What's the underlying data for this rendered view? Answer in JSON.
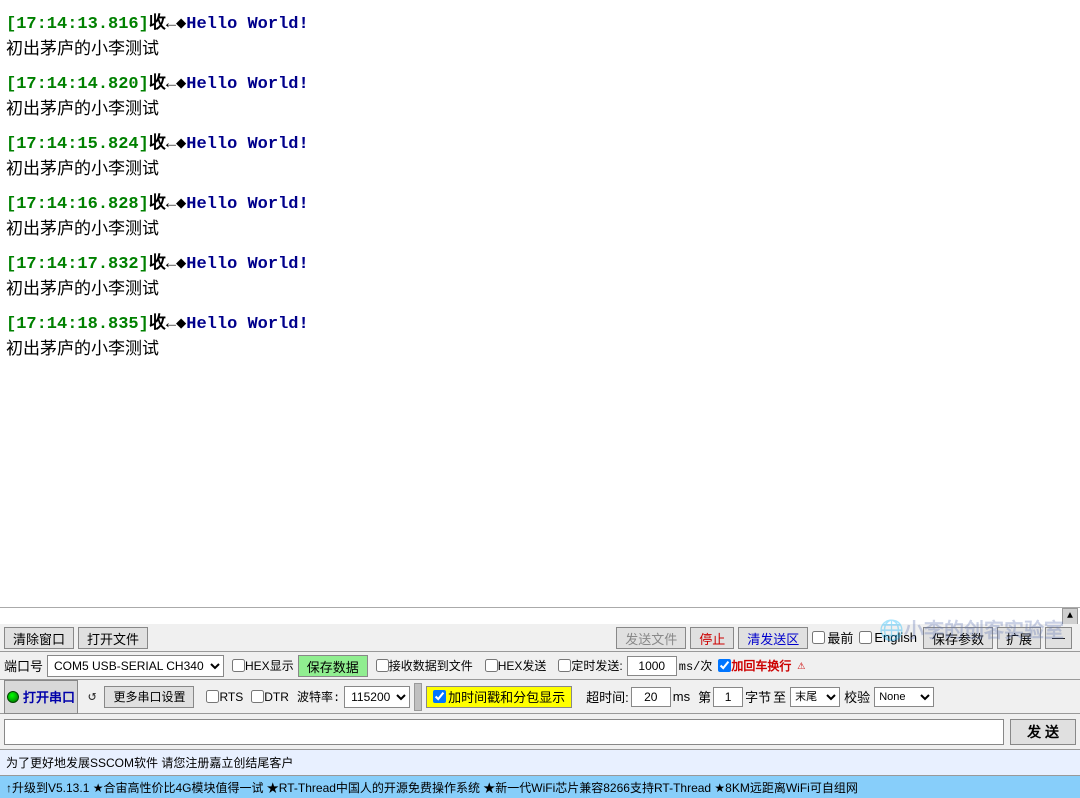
{
  "terminal": {
    "entries": [
      {
        "timestamp": "[17:14:13.816]",
        "label": "收←◆",
        "message": "Hello World!",
        "chinese": "初出茅庐的小李测试"
      },
      {
        "timestamp": "[17:14:14.820]",
        "label": "收←◆",
        "message": "Hello World!",
        "chinese": "初出茅庐的小李测试"
      },
      {
        "timestamp": "[17:14:15.824]",
        "label": "收←◆",
        "message": "Hello World!",
        "chinese": "初出茅庐的小李测试"
      },
      {
        "timestamp": "[17:14:16.828]",
        "label": "收←◆",
        "message": "Hello World!",
        "chinese": "初出茅庐的小李测试"
      },
      {
        "timestamp": "[17:14:17.832]",
        "label": "收←◆",
        "message": "Hello World!",
        "chinese": "初出茅庐的小李测试"
      },
      {
        "timestamp": "[17:14:18.835]",
        "label": "收←◆",
        "message": "Hello World!",
        "chinese": "初出茅庐的小李测试"
      }
    ]
  },
  "toolbar": {
    "clear_btn": "清除窗口",
    "open_file_btn": "打开文件",
    "send_file_btn": "发送文件",
    "stop_btn": "停止",
    "clear_send_btn": "清发送区",
    "last_checkbox": "最前",
    "english_checkbox": "English",
    "save_param_btn": "保存参数",
    "expand_btn": "扩展",
    "minimize_btn": "—"
  },
  "port_row": {
    "port_label": "端口号",
    "port_value": "COM5 USB-SERIAL CH340",
    "hex_display": "HEX显示",
    "save_data_btn": "保存数据",
    "receive_to_file": "接收数据到文件",
    "hex_send": "HEX发送",
    "timed_send": "定时发送:",
    "timed_value": "1000",
    "timed_unit": "ms/次",
    "newline": "加回车换行"
  },
  "open_row": {
    "open_port_btn": "打开串口",
    "refresh_icon": "↺",
    "multi_port": "更多串口设置",
    "add_time_label": "加时间戳和分包显示",
    "timeout_label": "超时间:",
    "timeout_value": "20",
    "timeout_unit": "ms",
    "byte_from": "第",
    "byte_from_val": "1",
    "byte_unit": "字节",
    "byte_to": "至",
    "byte_end": "末尾",
    "checksum_label": "校验",
    "checksum_value": "None",
    "rts_label": "RTS",
    "dtr_label": "DTR",
    "baud_label": "波特率:",
    "baud_value": "115200"
  },
  "send_row": {
    "send_input_value": "",
    "send_btn": "发 送"
  },
  "status_bar": {
    "text": "为了更好地发展SSCOM软件 请您注册嘉立创结尾客户"
  },
  "ticker": {
    "text": "↑升级到V5.13.1 ★合宙高性价比4G模块值得一试 ★RT-Thread中国人的开源免费操作系统 ★新一代WiFi芯片兼容8266支持RT-Thread ★8KM远距离WiFi可自组网"
  },
  "watermark": {
    "text": "🌐小李的创客实验室"
  }
}
